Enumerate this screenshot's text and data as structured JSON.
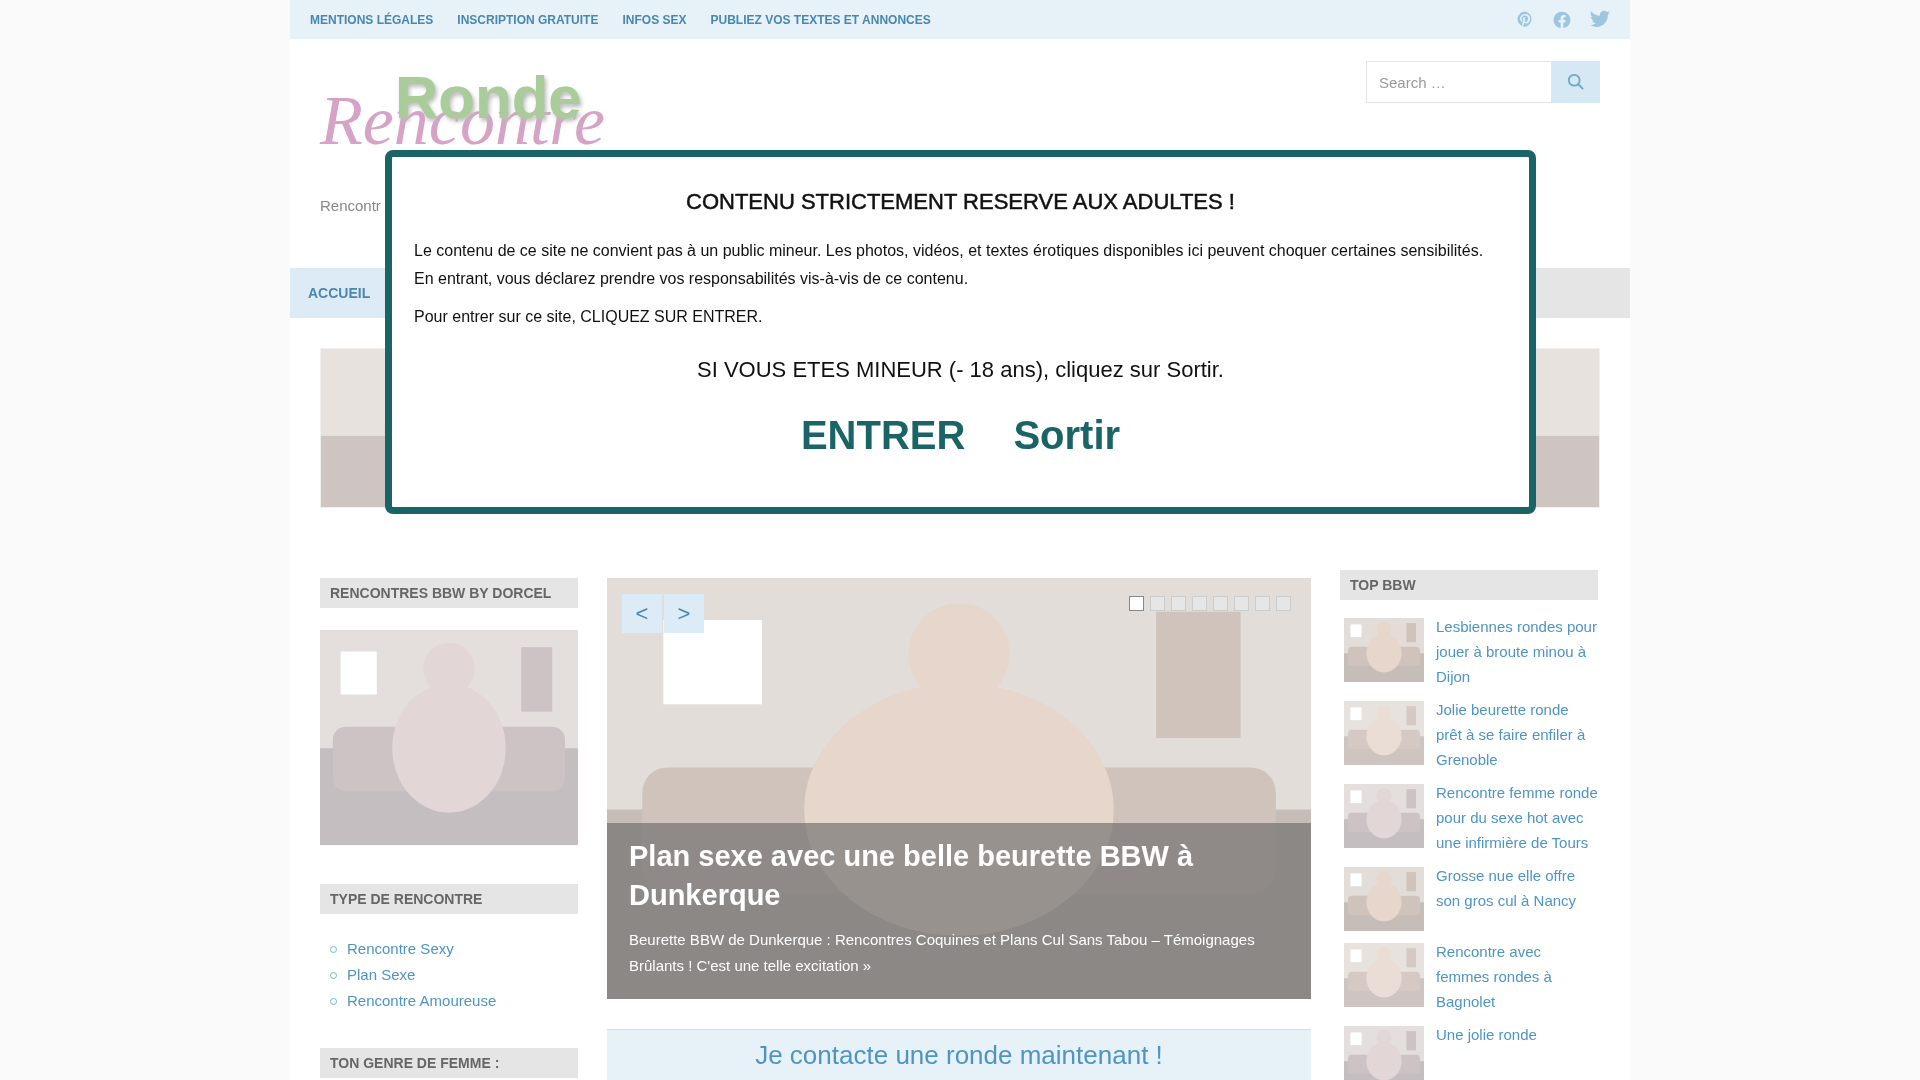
{
  "top_bar": {
    "links": [
      "MENTIONS LÉGALES",
      "INSCRIPTION GRATUITE",
      "INFOS SEX",
      "PUBLIEZ VOS TEXTES ET ANNONCES"
    ]
  },
  "header": {
    "logo": [
      "Ronde",
      "Rencontre"
    ],
    "tagline": "Rencontr",
    "search": {
      "placeholder": "Search …"
    }
  },
  "nav": {
    "items": [
      {
        "label": "ACCUEIL",
        "selected": true
      }
    ]
  },
  "left_sidebar": [
    {
      "kind": "ad",
      "title": "RENCONTRES BBW BY DORCEL"
    },
    {
      "kind": "list",
      "title": "TYPE DE RENCONTRE",
      "items": [
        "Rencontre Sexy",
        "Plan Sexe",
        "Rencontre Amoureuse"
      ]
    },
    {
      "kind": "heading",
      "title": "TON GENRE DE FEMME :"
    }
  ],
  "slider": {
    "prev": "<",
    "next": ">",
    "dots": [
      {
        "selected": true
      },
      {
        "selected": false
      },
      {
        "selected": false
      },
      {
        "selected": false
      },
      {
        "selected": false
      },
      {
        "selected": false
      },
      {
        "selected": false
      },
      {
        "selected": false
      }
    ],
    "title": "Plan sexe avec une belle beurette BBW à Dunkerque",
    "excerpt": "Beurette BBW de Dunkerque : Rencontres Coquines et Plans Cul Sans Tabou – Témoignages Brûlants ! C'est une telle excitation",
    "more": "»"
  },
  "cta": "Je contacte une ronde maintenant !",
  "right_sidebar": {
    "title": "TOP BBW",
    "posts": [
      {
        "title": "Lesbiennes rondes pour jouer à broute minou à Dijon"
      },
      {
        "title": "Jolie beurette ronde prêt à se faire enfiler à Grenoble"
      },
      {
        "title": "Rencontre femme ronde pour du sexe hot avec une infirmière de Tours"
      },
      {
        "title": "Grosse nue elle offre son gros cul à Nancy"
      },
      {
        "title": "Rencontre avec femmes rondes à Bagnolet"
      },
      {
        "title": "Une jolie ronde"
      }
    ]
  },
  "age_gate": {
    "title": "CONTENU STRICTEMENT RESERVE AUX ADULTES !",
    "paragraphs": [
      "Le contenu de ce site ne convient pas à un public mineur. Les photos, vidéos, et textes érotiques disponibles ici peuvent choquer certaines sensibilités.",
      "En entrant, vous déclarez prendre vos responsabilités vis-à-vis de ce contenu."
    ],
    "instruction": "Pour entrer sur ce site, CLIQUEZ SUR ENTRER.",
    "minor_notice": "SI VOUS ETES MINEUR (- 18 ans), cliquez sur Sortir.",
    "buttons": [
      "ENTRER",
      "Sortir"
    ]
  }
}
